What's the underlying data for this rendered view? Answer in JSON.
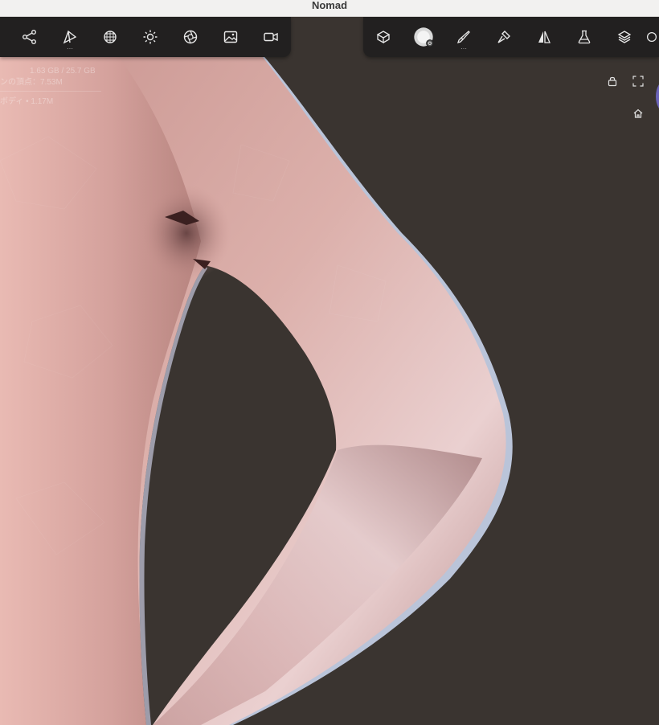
{
  "window": {
    "title": "Nomad"
  },
  "left_toolbar": {
    "items": [
      {
        "name": "scene-icon",
        "more": false
      },
      {
        "name": "mesh-tools-icon",
        "more": true
      },
      {
        "name": "topology-icon",
        "more": false
      },
      {
        "name": "light-icon",
        "more": false
      },
      {
        "name": "material-icon",
        "more": false
      },
      {
        "name": "background-icon",
        "more": false
      },
      {
        "name": "camera-icon",
        "more": false
      }
    ]
  },
  "right_toolbar": {
    "items": [
      {
        "name": "object-icon",
        "more": false
      },
      {
        "name": "brush-alpha-icon",
        "more": false
      },
      {
        "name": "paint-icon",
        "more": true
      },
      {
        "name": "stroke-icon",
        "more": false
      },
      {
        "name": "symmetry-icon",
        "more": false
      },
      {
        "name": "flask-icon",
        "more": false
      },
      {
        "name": "layers-icon",
        "more": false
      }
    ]
  },
  "stats": {
    "memory": "1.63 GB / 25.7 GB",
    "vertices": "ンの頂点：7.53M",
    "object": "ボディ • 1.17M"
  },
  "viewport_controls": {
    "lock": "lock-icon",
    "fullscreen": "fullscreen-icon",
    "home": "home-icon"
  },
  "colors": {
    "background": "#3a3430",
    "toolbar": "#222020",
    "skin": "#d9a7a2",
    "accent_avatar": "#6a63b8"
  }
}
